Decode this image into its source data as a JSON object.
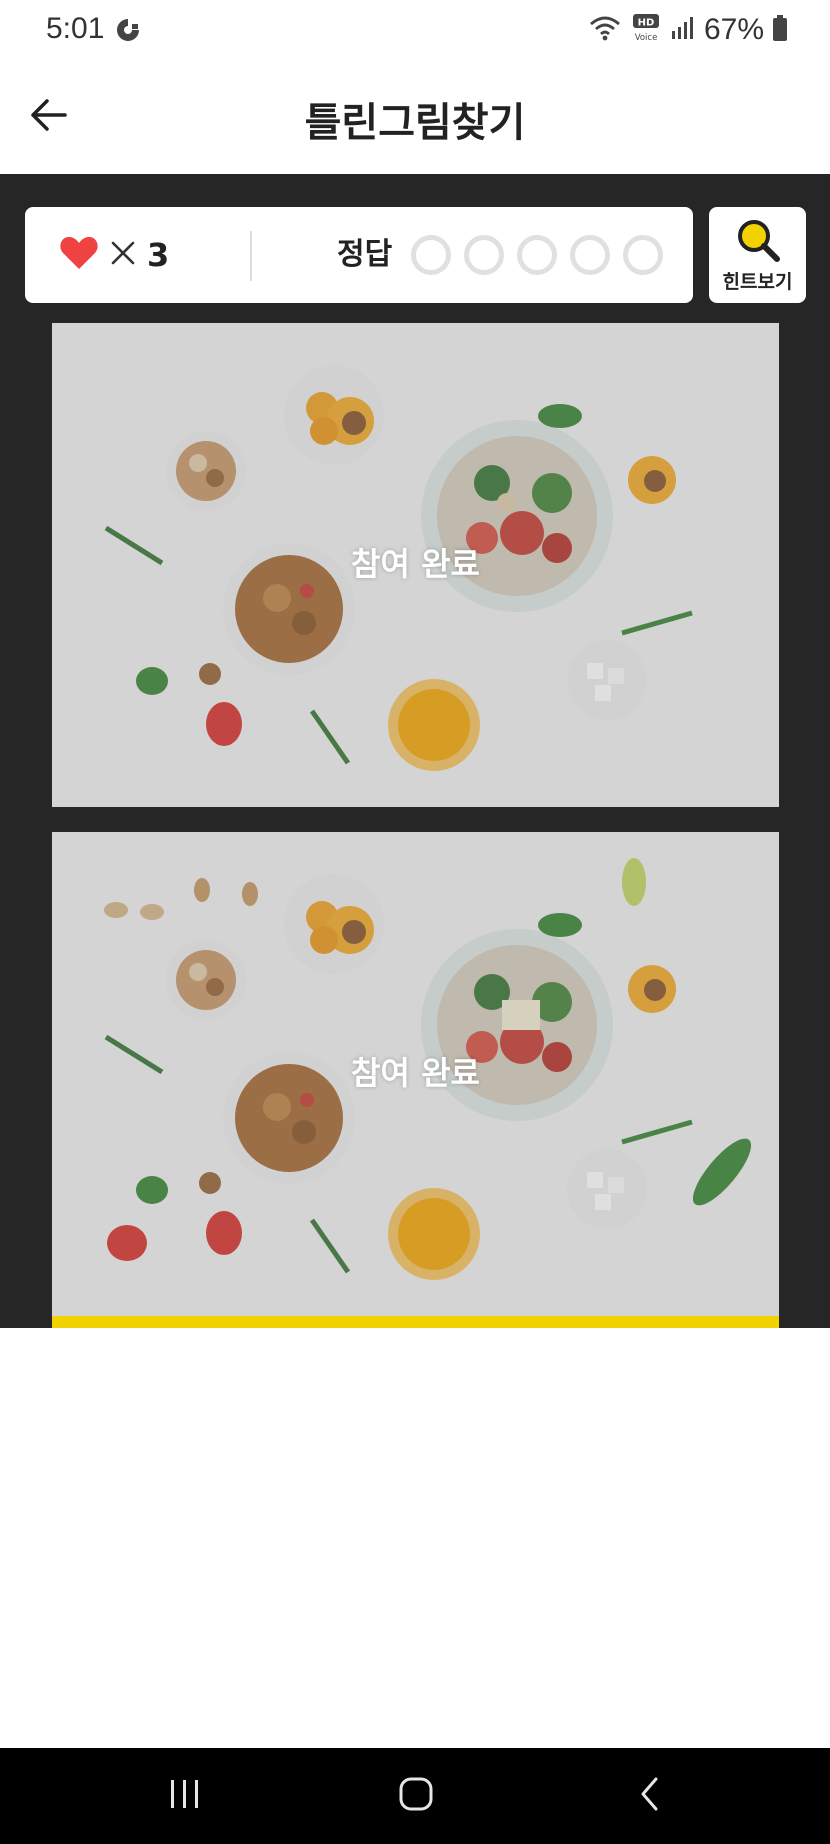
{
  "status_bar": {
    "time": "5:01",
    "battery": "67%",
    "hd_top": "HD",
    "hd_bottom": "Voice"
  },
  "header": {
    "title": "틀린그림찾기",
    "back_icon": "arrow-left-icon"
  },
  "score": {
    "lives_icon": "heart-icon",
    "lives_count": "3",
    "answer_label": "정답",
    "answers_total": 5,
    "answers_found": 0
  },
  "hint": {
    "label": "힌트보기",
    "icon": "magnifier-icon"
  },
  "puzzles": {
    "top": {
      "overlay_text": "참여 완료"
    },
    "bottom": {
      "overlay_text": "참여 완료"
    }
  },
  "colors": {
    "accent": "#f2d200",
    "game_background": "#262626",
    "heart": "#ef4343"
  }
}
